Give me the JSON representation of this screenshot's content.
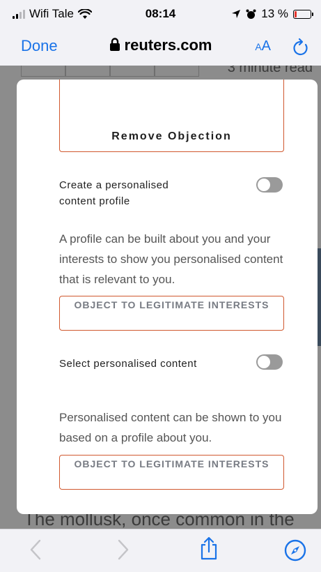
{
  "status_bar": {
    "carrier": "Wifi Tale",
    "time": "08:14",
    "battery": "13 %",
    "battery_level": 0.13,
    "battery_color": "#e5342b"
  },
  "nav": {
    "done": "Done",
    "url": "reuters.com",
    "text_size": {
      "small": "A",
      "large": "A"
    }
  },
  "background": {
    "read_time": "3 minute read",
    "article_text": "The mollusk, once common in the"
  },
  "modal": {
    "remove_objection": "Remove Objection",
    "items": [
      {
        "title": "Create a personalised content profile",
        "description": "A profile can be built about you and your interests to show you personalised content that is relevant to you.",
        "toggle_on": false,
        "button": "OBJECT TO LEGITIMATE INTERESTS"
      },
      {
        "title": "Select personalised content",
        "description": "Personalised content can be shown to you based on a profile about you.",
        "toggle_on": false,
        "button": "OBJECT TO LEGITIMATE INTERESTS"
      }
    ]
  },
  "icons": {
    "lock": "lock-icon",
    "reload": "reload-icon",
    "back": "chevron-left-icon",
    "forward": "chevron-right-icon",
    "share": "share-icon",
    "compass": "compass-icon"
  },
  "colors": {
    "accent": "#1a73e8",
    "button_border": "#d0582e",
    "toggle_off": "#9a9a9a"
  }
}
